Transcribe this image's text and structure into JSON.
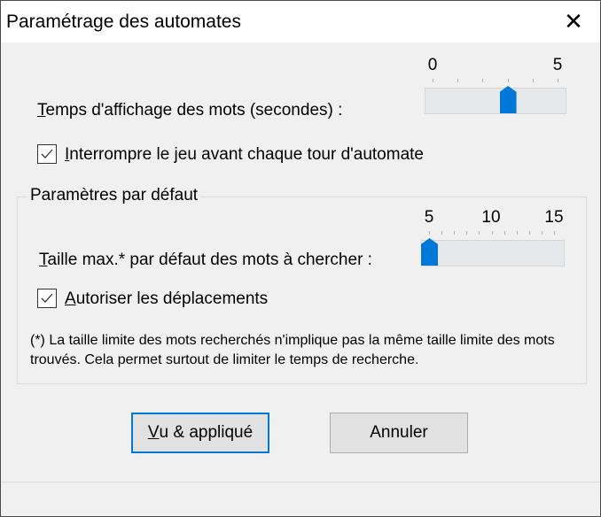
{
  "window": {
    "title": "Paramétrage des automates",
    "close_icon": "close-icon"
  },
  "display_time": {
    "label_mnemonic": "T",
    "label_rest": "emps d'affichage des mots (secondes) :",
    "slider": {
      "min": 0,
      "max": 5,
      "value": 3,
      "min_label": "0",
      "max_label": "5"
    }
  },
  "interrupt": {
    "label_mnemonic": "I",
    "label_rest": "nterrompre le jeu avant chaque tour d'automate",
    "checked": true
  },
  "defaults": {
    "title": "Paramètres par défaut",
    "max_size": {
      "label_mnemonic": "T",
      "label_rest": "aille max.* par défaut des mots à chercher :",
      "slider": {
        "min": 5,
        "max": 15,
        "value": 5,
        "labels": [
          "5",
          "10",
          "15"
        ]
      }
    },
    "moves": {
      "label_mnemonic": "A",
      "label_rest": "utoriser les déplacements",
      "checked": true
    },
    "footnote": "(*) La taille limite des mots recherchés n'implique pas la même taille limite des mots trouvés. Cela permet surtout de limiter le temps de recherche."
  },
  "buttons": {
    "ok_mnemonic": "V",
    "ok_rest": "u & appliqué",
    "cancel": "Annuler"
  },
  "colors": {
    "accent": "#0078d7"
  }
}
